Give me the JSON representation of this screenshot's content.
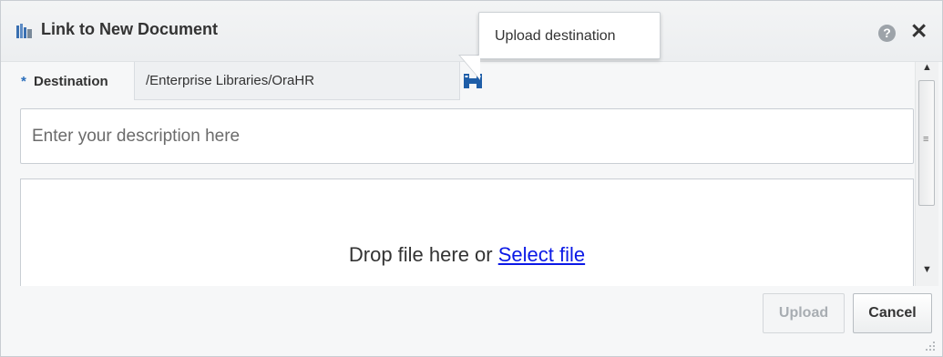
{
  "dialog": {
    "title": "Link to New Document",
    "help_glyph": "?",
    "close_glyph": "✕"
  },
  "tooltip": {
    "text": "Upload destination"
  },
  "form": {
    "required_marker": "*",
    "destination_label": "Destination",
    "destination_value": "/Enterprise Libraries/OraHR",
    "description_placeholder": "Enter your description here",
    "drop_text": "Drop file here or ",
    "select_file_link": "Select file"
  },
  "buttons": {
    "upload": "Upload",
    "cancel": "Cancel"
  },
  "icons": [
    "library-icon",
    "help-icon",
    "close-icon",
    "browse-folders-icon",
    "scroll-up-icon",
    "scroll-down-icon",
    "resize-grip-icon"
  ],
  "colors": {
    "link": "#0b19e6",
    "accent_icon": "#1f5ea8",
    "disabled_text": "#a8adb2"
  }
}
